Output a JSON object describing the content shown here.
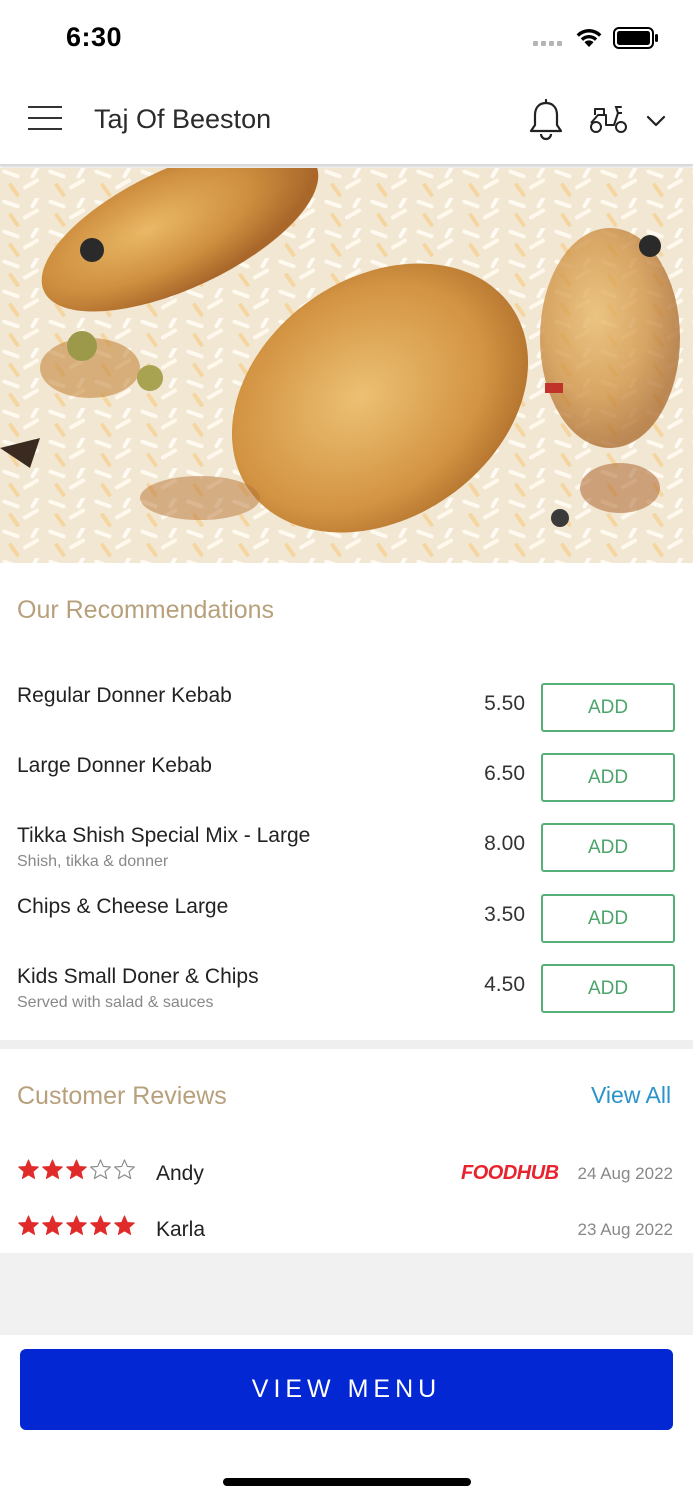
{
  "status_bar": {
    "time": "6:30"
  },
  "header": {
    "title": "Taj Of Beeston",
    "icons": [
      "hamburger-menu-icon",
      "bell-icon",
      "scooter-icon",
      "chevron-down-icon"
    ]
  },
  "recommendations": {
    "title": "Our Recommendations",
    "add_label": "ADD",
    "items": [
      {
        "name": "Regular Donner Kebab",
        "description": "",
        "price": "5.50"
      },
      {
        "name": "Large Donner Kebab",
        "description": "",
        "price": "6.50"
      },
      {
        "name": "Tikka Shish Special Mix - Large",
        "description": "Shish, tikka & donner",
        "price": "8.00"
      },
      {
        "name": "Chips & Cheese Large",
        "description": "",
        "price": "3.50"
      },
      {
        "name": "Kids Small Doner & Chips",
        "description": "Served with salad & sauces",
        "price": "4.50"
      }
    ]
  },
  "reviews": {
    "title": "Customer Reviews",
    "view_all": "View All",
    "items": [
      {
        "name": "Andy",
        "rating": 3,
        "max_rating": 5,
        "source": "FOODHUB",
        "date": "24 Aug 2022"
      },
      {
        "name": "Karla",
        "rating": 5,
        "max_rating": 5,
        "source": "",
        "date": "23 Aug 2022"
      }
    ]
  },
  "footer": {
    "button_label": "VIEW MENU"
  },
  "colors": {
    "accent_gold": "#b7a07b",
    "add_green": "#55b077",
    "link_blue": "#2a93c9",
    "primary_button": "#0427d4",
    "star_red": "#e02b2b",
    "foodhub_red": "#e8232d"
  }
}
